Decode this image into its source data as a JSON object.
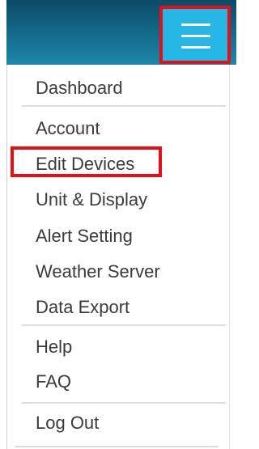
{
  "header": {
    "menu_icon": "hamburger-menu-icon",
    "highlight_color": "#e3101b"
  },
  "menu": {
    "items": [
      {
        "label": "Dashboard"
      },
      {
        "label": "Account"
      },
      {
        "label": "Edit Devices"
      },
      {
        "label": "Unit & Display"
      },
      {
        "label": "Alert Setting"
      },
      {
        "label": "Weather Server"
      },
      {
        "label": "Data Export"
      },
      {
        "label": "Help"
      },
      {
        "label": "FAQ"
      },
      {
        "label": "Log Out"
      }
    ]
  },
  "colors": {
    "header_top": "#0b4a66",
    "header_bottom": "#1f86aa",
    "menu_button": "#26b6e6",
    "text": "#3b3b3b",
    "divider": "#dedede"
  }
}
